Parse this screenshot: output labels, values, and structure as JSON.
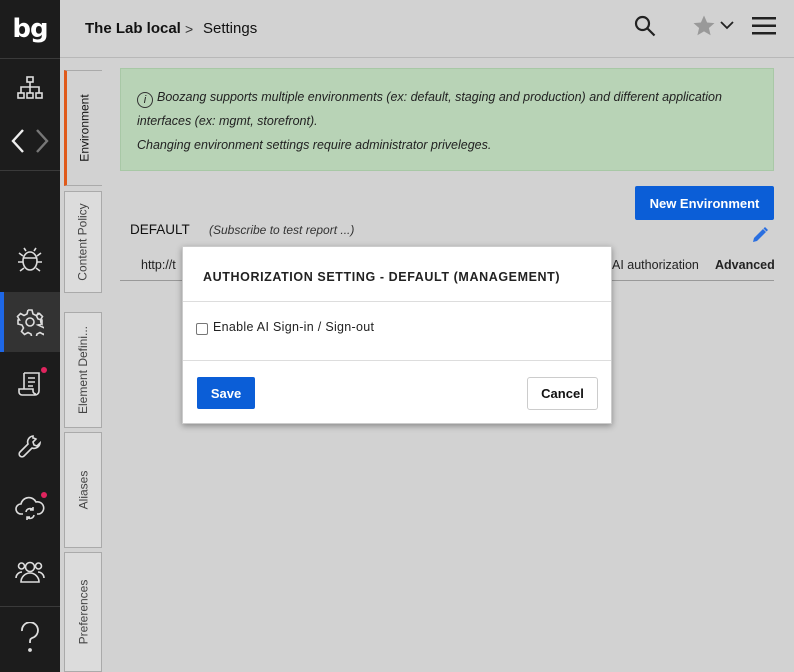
{
  "app": {
    "logo": "bg"
  },
  "breadcrumb": {
    "root": "The Lab local",
    "separator": ">",
    "page": "Settings"
  },
  "tabs": [
    {
      "label": "Environment"
    },
    {
      "label": "Content Policy"
    },
    {
      "label": "Element Defini..."
    },
    {
      "label": "Aliases"
    },
    {
      "label": "Preferences"
    }
  ],
  "info": {
    "line1": "Boozang supports multiple environments (ex: default, staging and production) and different application",
    "line2": "interfaces (ex: mgmt, storefront).",
    "line3": "Changing environment settings require administrator priveleges."
  },
  "toolbar": {
    "new_env_label": "New Environment"
  },
  "environment": {
    "name": "DEFAULT",
    "subscribe": "(Subscribe to test report ...)",
    "url": "http://t",
    "ai_auth": "AI authorization",
    "advanced": "Advanced"
  },
  "dialog": {
    "title": "AUTHORIZATION SETTING - DEFAULT (MANAGEMENT)",
    "checkbox_label": "Enable AI Sign-in / Sign-out",
    "save_label": "Save",
    "cancel_label": "Cancel"
  },
  "colors": {
    "accent": "#0b5ed7",
    "active_tab": "#e05a1a",
    "info_bg": "#b8d3b6",
    "badge": "#e0245e"
  }
}
